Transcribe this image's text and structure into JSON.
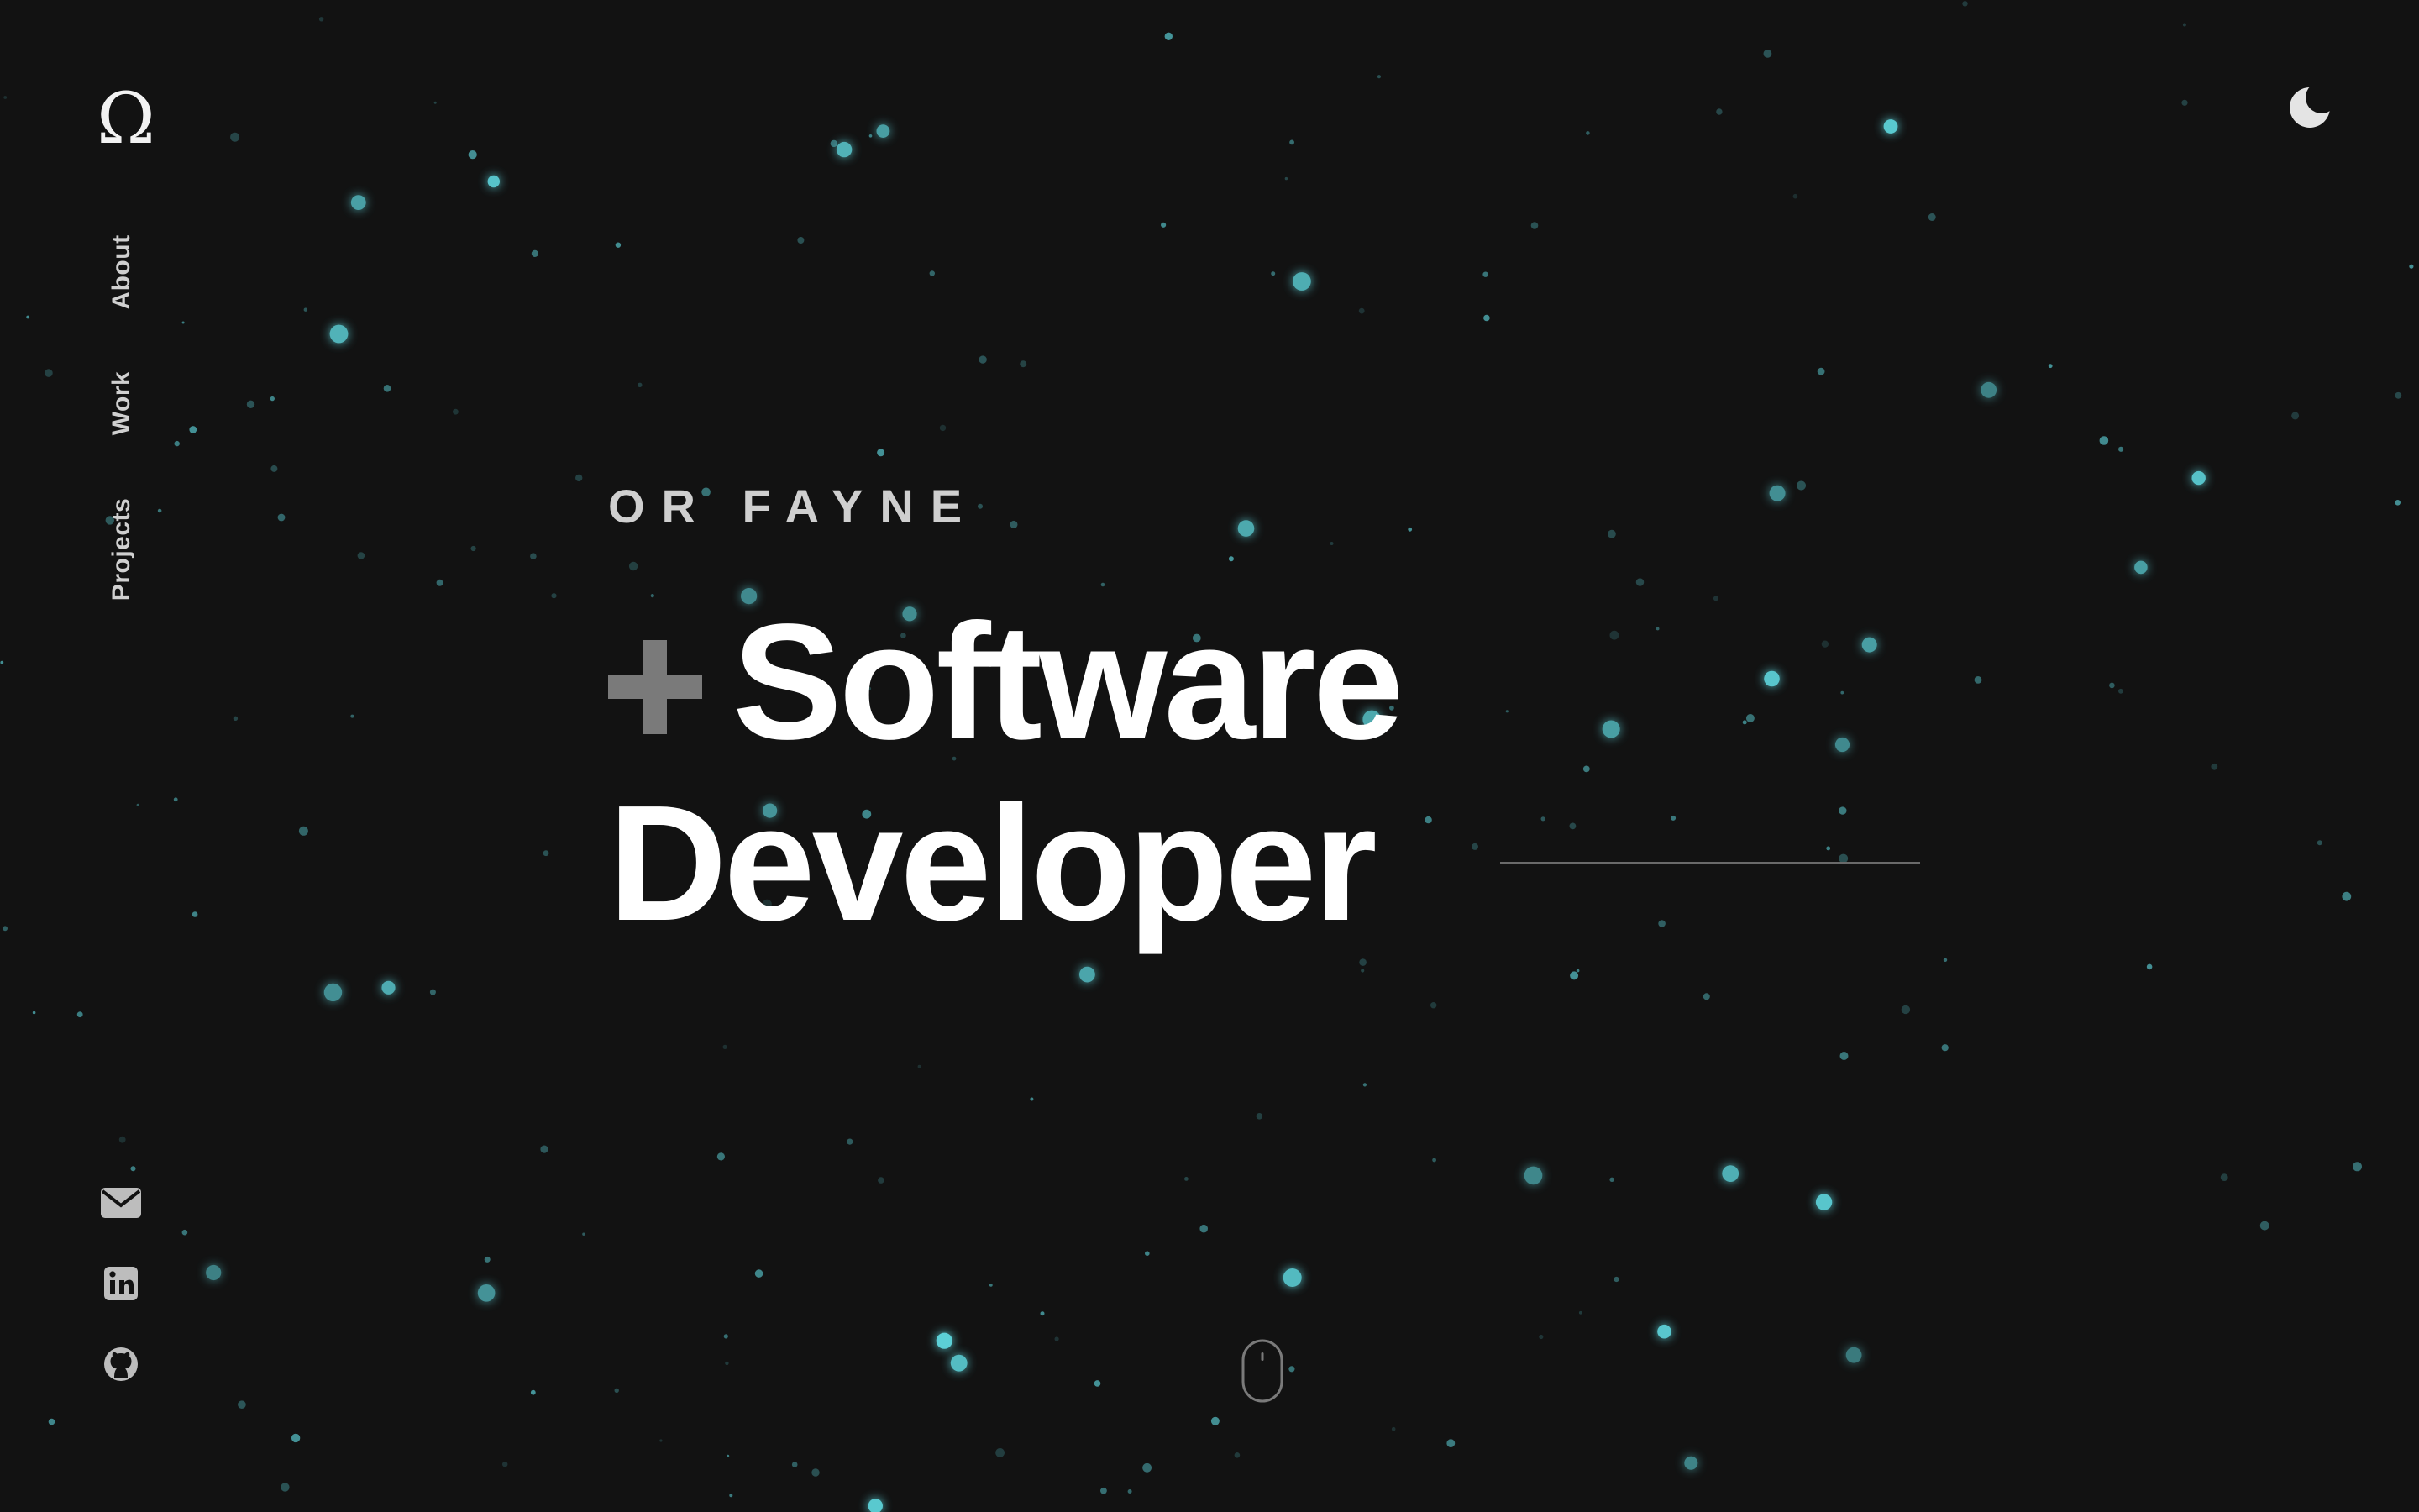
{
  "brand": {
    "logo_glyph": "Ω"
  },
  "nav": {
    "items": [
      {
        "label": "About"
      },
      {
        "label": "Work"
      },
      {
        "label": "Projects"
      }
    ]
  },
  "hero": {
    "name": "OR FAYNE",
    "role_line_1": "Software",
    "role_line_2": "Developer"
  },
  "icons": {
    "logo": "omega-logo",
    "theme_toggle": "moon-icon",
    "social": [
      "email-icon",
      "linkedin-icon",
      "github-icon"
    ],
    "scroll": "mouse-scroll-icon"
  },
  "colors": {
    "background": "#121212",
    "text_primary": "#ffffff",
    "text_secondary": "#cfcfcf",
    "accent_particles": "#5ccfd6",
    "muted": "#7a7a7a"
  }
}
